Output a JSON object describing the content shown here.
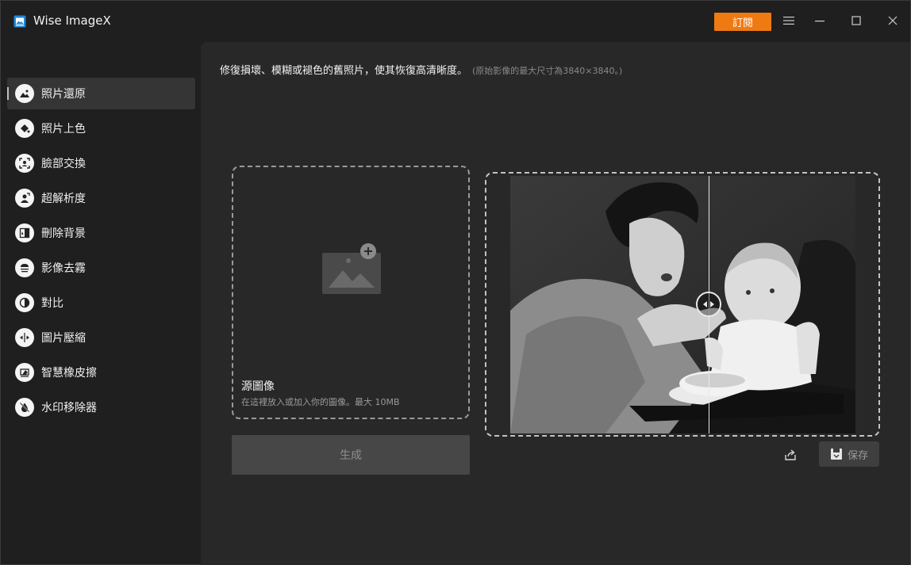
{
  "window": {
    "title": "Wise ImageX",
    "subscribe_label": "訂閱"
  },
  "sidebar": {
    "items": [
      {
        "label": "照片還原",
        "icon": "image-restore-icon",
        "active": true
      },
      {
        "label": "照片上色",
        "icon": "paint-bucket-icon",
        "active": false
      },
      {
        "label": "臉部交換",
        "icon": "face-swap-icon",
        "active": false
      },
      {
        "label": "超解析度",
        "icon": "super-resolution-icon",
        "active": false
      },
      {
        "label": "刪除背景",
        "icon": "remove-background-icon",
        "active": false
      },
      {
        "label": "影像去霧",
        "icon": "dehaze-icon",
        "active": false
      },
      {
        "label": "對比",
        "icon": "contrast-icon",
        "active": false
      },
      {
        "label": "圖片壓縮",
        "icon": "compress-icon",
        "active": false
      },
      {
        "label": "智慧橡皮擦",
        "icon": "eraser-icon",
        "active": false
      },
      {
        "label": "水印移除器",
        "icon": "watermark-remove-icon",
        "active": false
      }
    ]
  },
  "main": {
    "description": "修復損壞、模糊或褪色的舊照片，使其恢復高清晰度。",
    "description_note": "(原始影像的最大尺寸為3840×3840。)",
    "dropzone": {
      "title": "源圖像",
      "subtitle": "在這裡放入或加入你的圖像。最大 10MB"
    },
    "generate_label": "生成",
    "save_label": "保存"
  },
  "colors": {
    "accent": "#f07a12",
    "background": "#1f1f1f",
    "panel": "#282828"
  }
}
